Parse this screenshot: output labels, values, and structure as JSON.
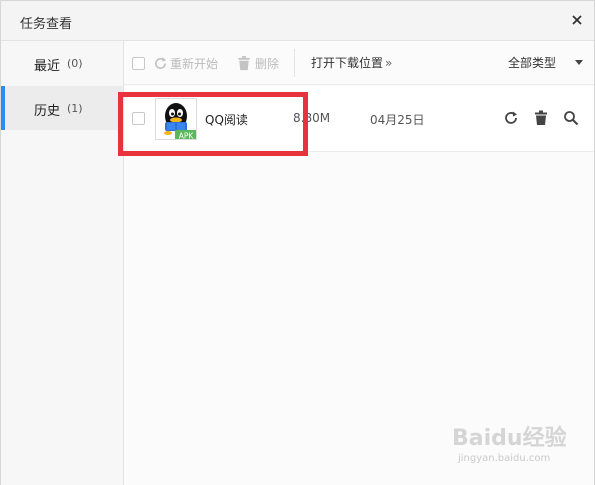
{
  "window": {
    "title": "任务查看"
  },
  "sidebar": {
    "items": [
      {
        "label": "最近",
        "count": "(0)"
      },
      {
        "label": "历史",
        "count": "(1)"
      }
    ]
  },
  "toolbar": {
    "restart_label": "重新开始",
    "delete_label": "删除",
    "open_location_label": "打开下载位置",
    "open_location_arrow": "»",
    "type_filter_label": "全部类型"
  },
  "downloads": [
    {
      "name": "QQ阅读",
      "icon_badge": "APK",
      "size": "8.80M",
      "date": "04月25日"
    }
  ],
  "watermark": {
    "brand": "Baidu经验",
    "url": "jingyan.baidu.com"
  },
  "colors": {
    "accent": "#2d8cf0",
    "highlight": "#e8323c",
    "apk_badge": "#5cb85c"
  }
}
